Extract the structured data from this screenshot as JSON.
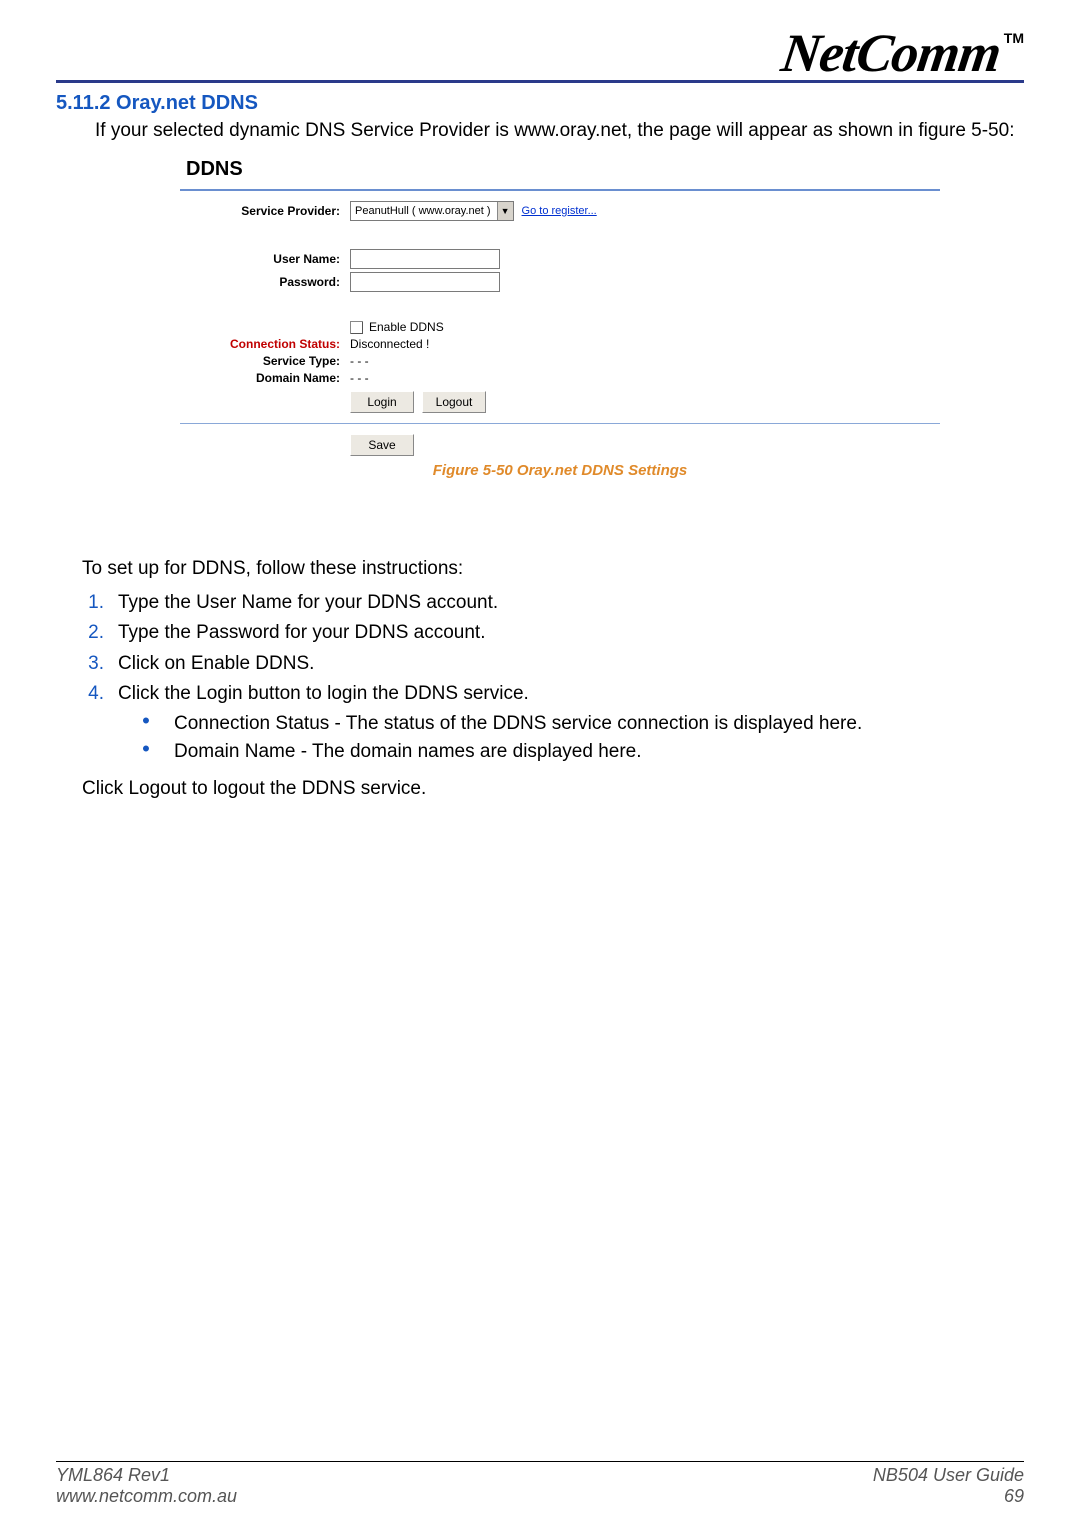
{
  "logo": {
    "text": "NetComm",
    "tm": "TM"
  },
  "heading": "5.11.2 Oray.net DDNS",
  "intro": "If your selected dynamic DNS Service Provider is www.oray.net, the page will appear as shown in figure 5-50:",
  "figure": {
    "title": "DDNS",
    "rows": {
      "service_provider": {
        "label": "Service Provider:",
        "value": "PeanutHull ( www.oray.net )",
        "link": "Go to register..."
      },
      "user_name": {
        "label": "User Name:"
      },
      "password": {
        "label": "Password:"
      },
      "enable": {
        "label": "Enable DDNS"
      },
      "conn_status": {
        "label": "Connection Status:",
        "value": "Disconnected !"
      },
      "service_type": {
        "label": "Service Type:",
        "value": "- - -"
      },
      "domain_name": {
        "label": "Domain Name:",
        "value": "- - -"
      }
    },
    "buttons": {
      "login": "Login",
      "logout": "Logout",
      "save": "Save"
    },
    "caption": "Figure 5-50 Oray.net DDNS Settings"
  },
  "instructions": {
    "lead": "To set up for DDNS, follow these instructions:",
    "items": [
      "Type the User Name for your DDNS account.",
      "Type the Password for your DDNS account.",
      "Click on Enable DDNS.",
      "Click the Login button to login the DDNS service."
    ],
    "bullets": [
      "Connection Status - The status of the DDNS service connection is displayed here.",
      "Domain Name - The domain names are displayed here."
    ],
    "closing": "Click Logout to logout the DDNS service."
  },
  "footer": {
    "left1": "YML864 Rev1",
    "left2": "www.netcomm.com.au",
    "right1": "NB504 User Guide",
    "right2": "69"
  }
}
